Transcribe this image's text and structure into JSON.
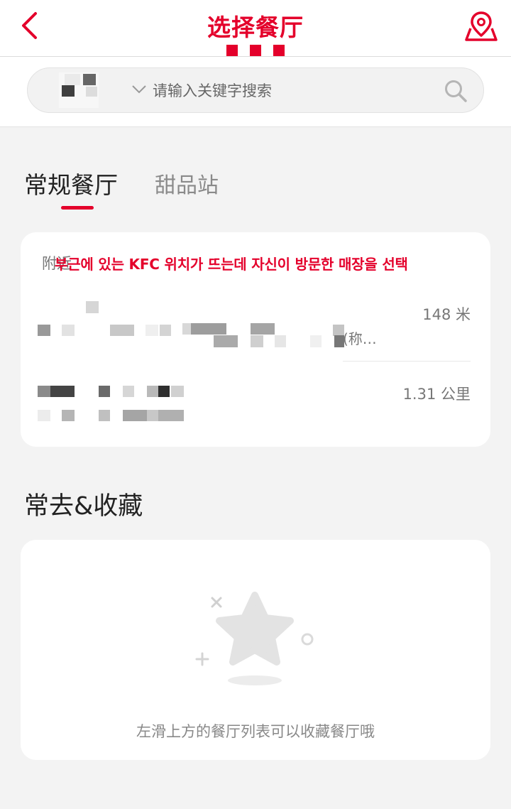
{
  "header": {
    "title": "选择餐厅"
  },
  "search": {
    "placeholder": "请输入关键字搜索"
  },
  "tabs": [
    {
      "label": "常规餐厅",
      "active": true
    },
    {
      "label": "甜品站",
      "active": false
    }
  ],
  "nearby": {
    "label": "附近",
    "overlay_note": "부근에 있는 KFC 위치가 뜨는데 자신이 방문한 매장을 선택",
    "stores": [
      {
        "distance": "148 米",
        "address_tail": "(称…"
      },
      {
        "distance": "1.31 公里"
      }
    ]
  },
  "favorites": {
    "title": "常去&收藏",
    "empty_hint": "左滑上方的餐厅列表可以收藏餐厅哦"
  },
  "colors": {
    "brand_red": "#e4002b",
    "background": "#f3f3f3",
    "card": "#ffffff"
  },
  "icons": {
    "back": "chevron-left-icon",
    "map": "map-pin-icon",
    "search": "search-icon",
    "dropdown": "chevron-down-icon",
    "empty": "star-icon"
  }
}
